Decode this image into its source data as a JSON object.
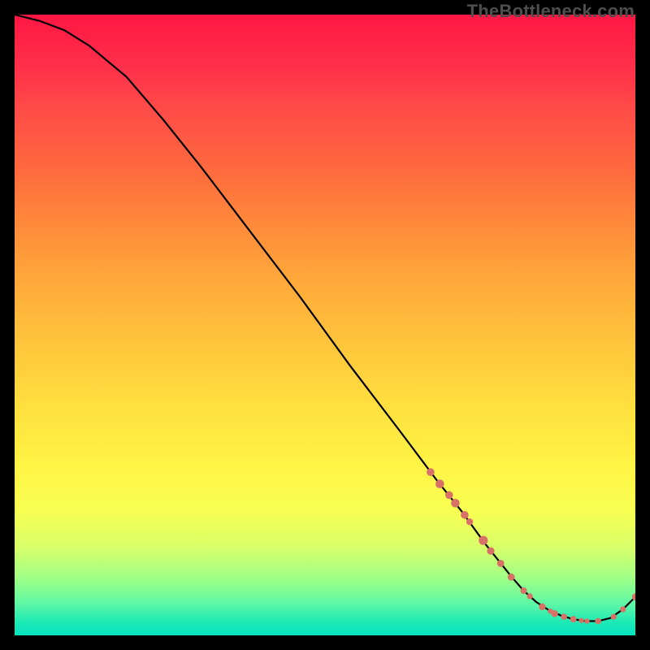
{
  "watermark": "TheBottleneck.com",
  "chart_data": {
    "type": "line",
    "title": "",
    "xlabel": "",
    "ylabel": "",
    "xlim": [
      0,
      100
    ],
    "ylim": [
      0,
      100
    ],
    "series": [
      {
        "name": "curve",
        "x": [
          0,
          4,
          8,
          12,
          18,
          24,
          30,
          38,
          46,
          54,
          62,
          68,
          72,
          76,
          80,
          82,
          84,
          86,
          88,
          90,
          92,
          94,
          96,
          98,
          100
        ],
        "y": [
          100,
          99,
          97.5,
          95,
          90,
          83,
          75.5,
          65,
          54.5,
          43.5,
          33,
          25,
          20,
          14.5,
          9.5,
          7.2,
          5.4,
          4.1,
          3.2,
          2.6,
          2.3,
          2.3,
          2.8,
          4.2,
          6.2
        ]
      }
    ],
    "markers": [
      {
        "x": 67.0,
        "y": 26.3,
        "r": 4.8
      },
      {
        "x": 68.5,
        "y": 24.4,
        "r": 5.3
      },
      {
        "x": 70.0,
        "y": 22.6,
        "r": 4.8
      },
      {
        "x": 71.0,
        "y": 21.3,
        "r": 5.3
      },
      {
        "x": 72.5,
        "y": 19.4,
        "r": 4.8
      },
      {
        "x": 73.3,
        "y": 18.3,
        "r": 4.2
      },
      {
        "x": 75.5,
        "y": 15.3,
        "r": 5.6
      },
      {
        "x": 76.7,
        "y": 13.6,
        "r": 4.6
      },
      {
        "x": 78.3,
        "y": 11.6,
        "r": 4.4
      },
      {
        "x": 80.0,
        "y": 9.4,
        "r": 4.4
      },
      {
        "x": 82.0,
        "y": 7.2,
        "r": 4.0
      },
      {
        "x": 83.0,
        "y": 6.3,
        "r": 3.6
      },
      {
        "x": 85.0,
        "y": 4.6,
        "r": 4.2
      },
      {
        "x": 86.3,
        "y": 3.9,
        "r": 3.2
      },
      {
        "x": 87.0,
        "y": 3.5,
        "r": 4.2
      },
      {
        "x": 88.5,
        "y": 3.0,
        "r": 3.8
      },
      {
        "x": 90.0,
        "y": 2.6,
        "r": 4.0
      },
      {
        "x": 91.3,
        "y": 2.4,
        "r": 3.2
      },
      {
        "x": 92.2,
        "y": 2.3,
        "r": 3.2
      },
      {
        "x": 94.0,
        "y": 2.3,
        "r": 3.8
      },
      {
        "x": 96.5,
        "y": 3.0,
        "r": 3.6
      },
      {
        "x": 98.0,
        "y": 4.2,
        "r": 3.6
      },
      {
        "x": 100.0,
        "y": 6.2,
        "r": 4.2
      }
    ],
    "colors": {
      "line": "#000000",
      "marker": "#d87266"
    }
  }
}
